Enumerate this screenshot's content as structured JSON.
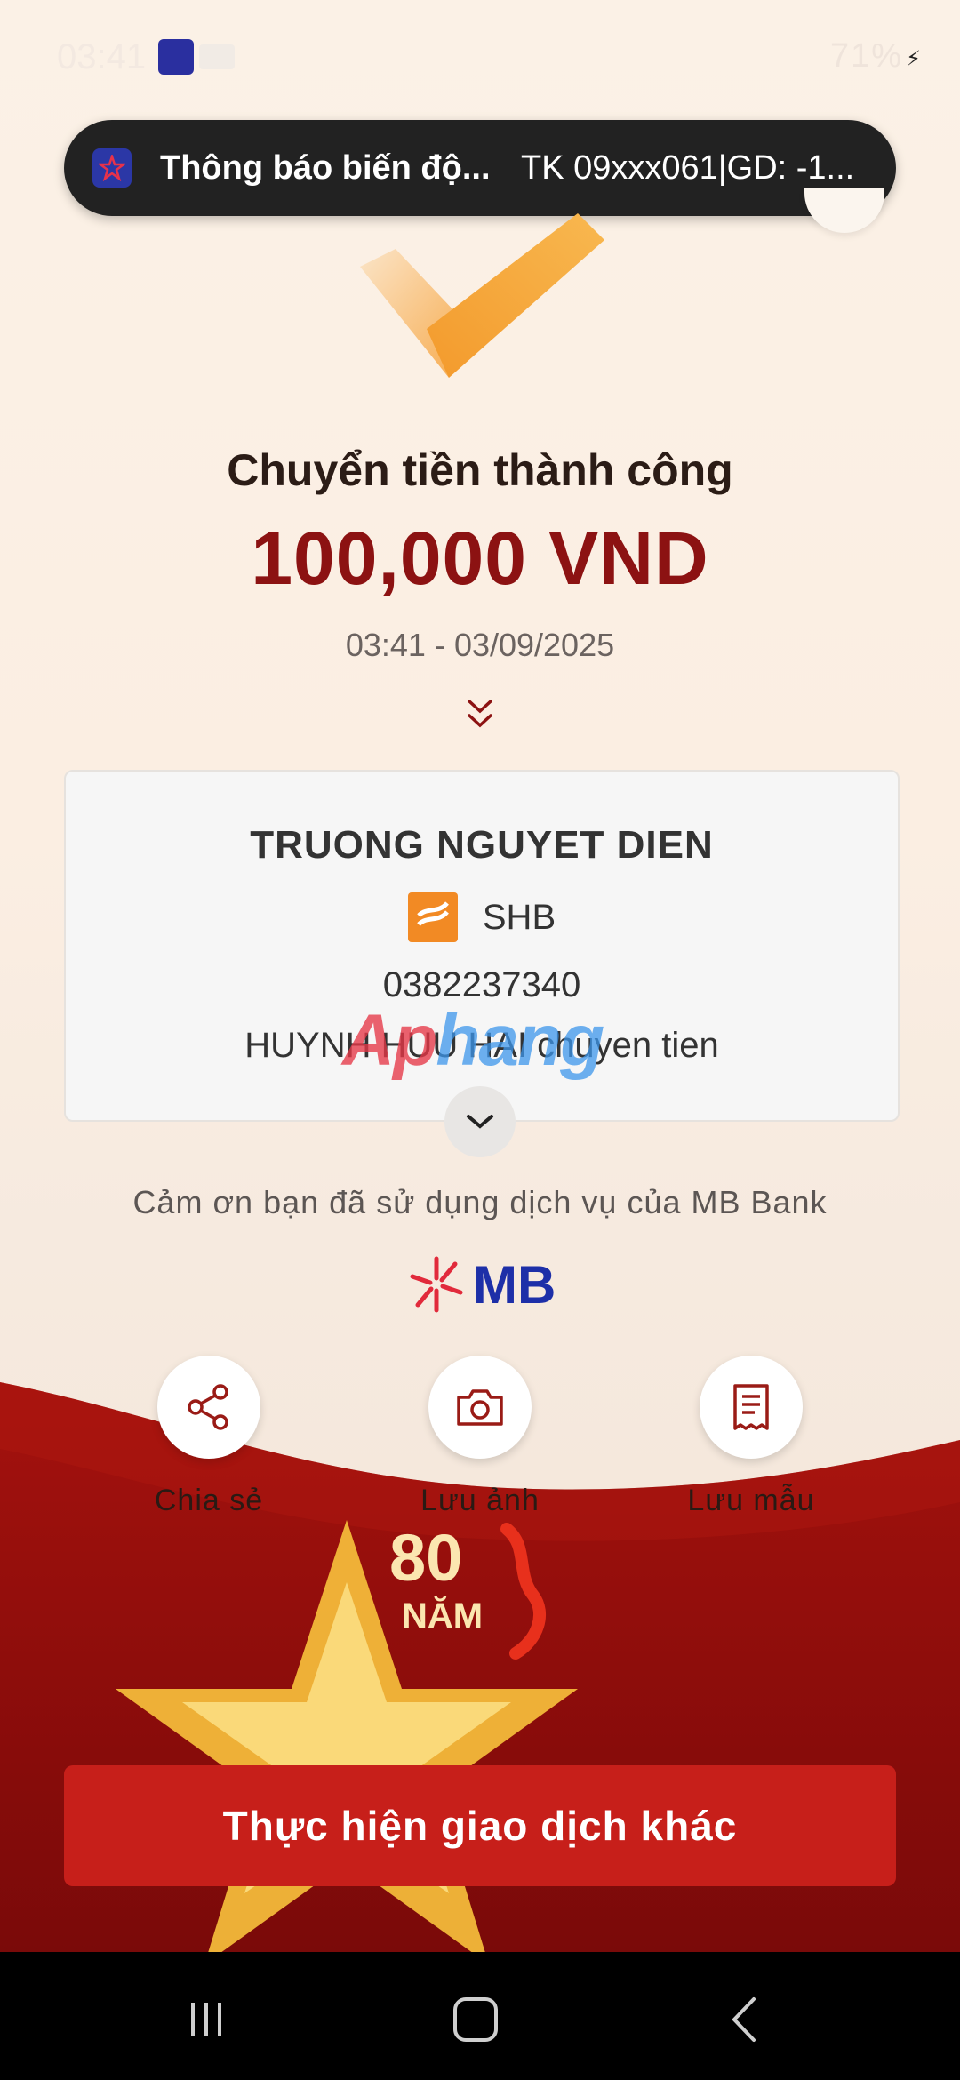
{
  "status_bar": {
    "time": "03:41",
    "battery": "71%"
  },
  "notification": {
    "title": "Thông báo biến độ...",
    "body": "TK 09xxx061|GD: -1..."
  },
  "result": {
    "title": "Chuyển tiền thành công",
    "amount": "100,000 VND",
    "datetime": "03:41 - 03/09/2025"
  },
  "receiver": {
    "name": "TRUONG NGUYET DIEN",
    "bank": "SHB",
    "account": "0382237340",
    "memo": "HUYNH HUU HAI chuyen tien"
  },
  "watermark": {
    "part1": "Ap",
    "part2": "hang"
  },
  "thanks": "Cảm ơn bạn đã sử dụng dịch vụ của MB Bank",
  "brand": {
    "logo_text": "MB"
  },
  "actions": [
    {
      "label": "Chia sẻ",
      "icon": "share-icon"
    },
    {
      "label": "Lưu ảnh",
      "icon": "camera-icon"
    },
    {
      "label": "Lưu mẫu",
      "icon": "receipt-icon"
    }
  ],
  "anniversary": {
    "number": "80",
    "word": "NĂM"
  },
  "primary_button": "Thực hiện giao dịch khác",
  "colors": {
    "amount": "#8c1212",
    "button": "#c71f1a",
    "brand_blue": "#1d2fa8",
    "accent_orange": "#f5a33a"
  }
}
